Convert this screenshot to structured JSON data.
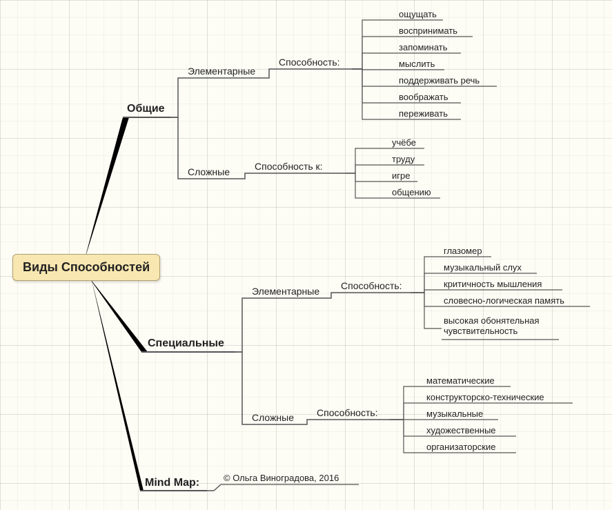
{
  "root": "Виды Способностей",
  "branches": {
    "general": {
      "label": "Общие",
      "elementary": {
        "label": "Элементарные",
        "ability_label": "Способность:",
        "items": [
          "ощущать",
          "воспринимать",
          "запоминать",
          "мыслить",
          "поддерживать речь",
          "воображать",
          "переживать"
        ]
      },
      "complex": {
        "label": "Сложные",
        "ability_label": "Способность к:",
        "items": [
          "учёбе",
          "труду",
          "игре",
          "общению"
        ]
      }
    },
    "special": {
      "label": "Специальные",
      "elementary": {
        "label": "Элементарные",
        "ability_label": "Способность:",
        "items": [
          "глазомер",
          "музыкальный слух",
          "критичность мышления",
          "словесно-логическая память",
          "высокая обонятельная чувствительность"
        ]
      },
      "complex": {
        "label": "Сложные",
        "ability_label": "Способность:",
        "items": [
          "математические",
          "конструкторско-технические",
          "музыкальные",
          "художественные",
          "организаторские"
        ]
      }
    },
    "mindmap": {
      "label": "Mind Map:",
      "credit": "© Ольга Виноградова, 2016"
    }
  }
}
